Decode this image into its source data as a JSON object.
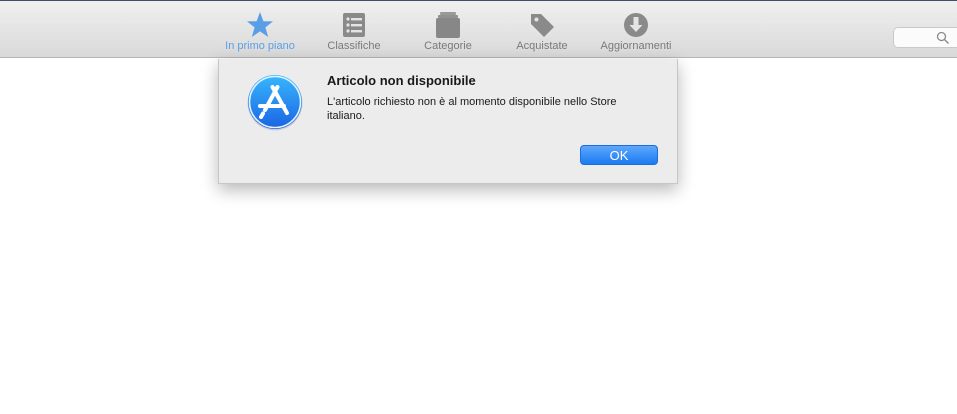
{
  "toolbar": {
    "tabs": [
      {
        "label": "In primo piano",
        "icon": "star-icon",
        "active": true
      },
      {
        "label": "Classifiche",
        "icon": "list-icon",
        "active": false
      },
      {
        "label": "Categorie",
        "icon": "stack-icon",
        "active": false
      },
      {
        "label": "Acquistate",
        "icon": "tag-icon",
        "active": false
      },
      {
        "label": "Aggiornamenti",
        "icon": "download-icon",
        "active": false
      }
    ],
    "search": {
      "icon": "search-icon",
      "placeholder": ""
    },
    "colors": {
      "active": "#5b9ee8",
      "inactive": "#7a7a7a"
    }
  },
  "dialog": {
    "icon": "app-store-icon",
    "title": "Articolo non disponibile",
    "message": "L'articolo richiesto non è al momento disponibile nello Store italiano.",
    "ok_label": "OK",
    "accent": "#1a7bf2"
  }
}
